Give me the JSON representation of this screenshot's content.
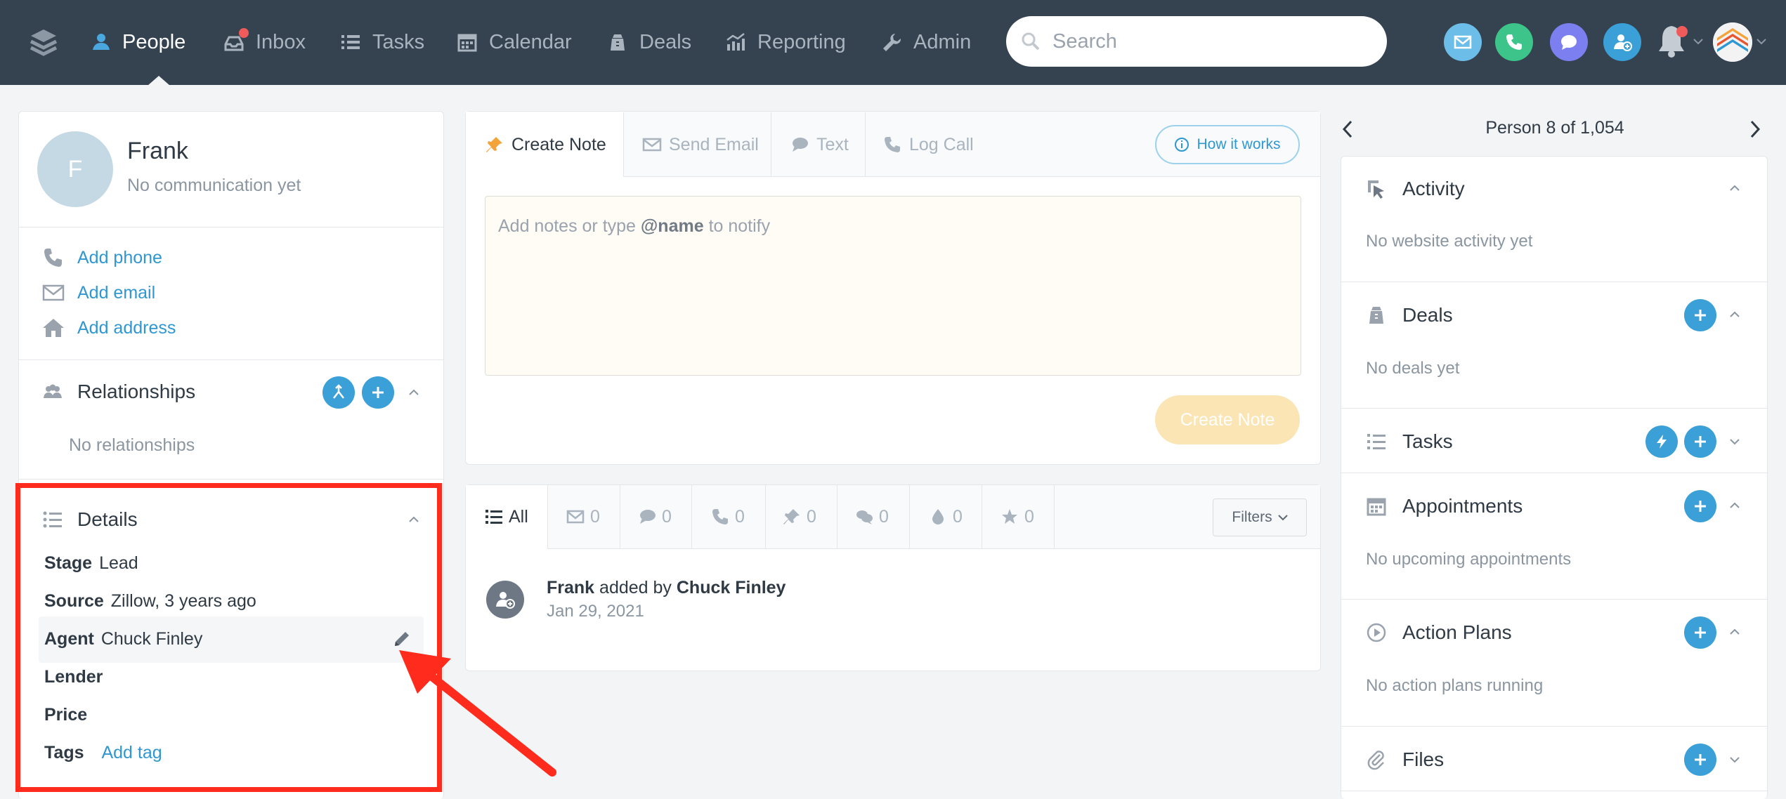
{
  "nav": {
    "items": [
      {
        "label": "People",
        "icon": "person-icon"
      },
      {
        "label": "Inbox",
        "icon": "inbox-icon"
      },
      {
        "label": "Tasks",
        "icon": "list-icon"
      },
      {
        "label": "Calendar",
        "icon": "calendar-icon"
      },
      {
        "label": "Deals",
        "icon": "deal-icon"
      },
      {
        "label": "Reporting",
        "icon": "chart-icon"
      },
      {
        "label": "Admin",
        "icon": "wrench-icon"
      }
    ],
    "search_placeholder": "Search"
  },
  "contact": {
    "initial": "F",
    "name": "Frank",
    "status": "No communication yet",
    "add_phone": "Add phone",
    "add_email": "Add email",
    "add_address": "Add address"
  },
  "relationships": {
    "title": "Relationships",
    "empty": "No relationships"
  },
  "details": {
    "title": "Details",
    "stage_label": "Stage",
    "stage_value": "Lead",
    "source_label": "Source",
    "source_value": "Zillow, 3 years ago",
    "agent_label": "Agent",
    "agent_value": "Chuck Finley",
    "lender_label": "Lender",
    "price_label": "Price",
    "tags_label": "Tags",
    "add_tag": "Add tag"
  },
  "composer": {
    "tabs": [
      "Create Note",
      "Send Email",
      "Text",
      "Log Call"
    ],
    "how_it_works": "How it works",
    "placeholder_prefix": "Add notes or type",
    "placeholder_mention": "@name",
    "placeholder_suffix": "to notify",
    "submit": "Create Note"
  },
  "feed": {
    "filters": [
      {
        "label": "All"
      },
      {
        "label": "0"
      },
      {
        "label": "0"
      },
      {
        "label": "0"
      },
      {
        "label": "0"
      },
      {
        "label": "0"
      },
      {
        "label": "0"
      },
      {
        "label": "0"
      }
    ],
    "filters_button": "Filters",
    "entry": {
      "subject": "Frank",
      "verb": "added by",
      "actor": "Chuck Finley",
      "date": "Jan 29, 2021"
    }
  },
  "sidebar": {
    "pager": "Person 8 of 1,054",
    "sections": [
      {
        "title": "Activity",
        "empty": "No website activity yet"
      },
      {
        "title": "Deals",
        "empty": "No deals yet"
      },
      {
        "title": "Tasks"
      },
      {
        "title": "Appointments",
        "empty": "No upcoming appointments"
      },
      {
        "title": "Action Plans",
        "empty": "No action plans running"
      },
      {
        "title": "Files"
      }
    ]
  },
  "colors": {
    "topbar": "#35424f",
    "accent": "#3b9fd8",
    "highlight": "#ff2b1c"
  }
}
